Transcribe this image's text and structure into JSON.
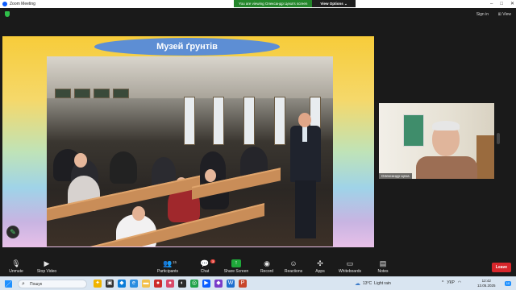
{
  "window": {
    "title": "Zoom Meeting",
    "controls": [
      "–",
      "□",
      "✕"
    ]
  },
  "view_banner": {
    "message": "You are viewing Олександр Цеха's screen",
    "options_label": "View Options ⌄"
  },
  "topbar": {
    "sign_in": "Sign in",
    "view": "⊞ View"
  },
  "slide": {
    "title": "Музей ґрунтів"
  },
  "participant_video": {
    "name": "Олександр Цеха"
  },
  "toolbar": {
    "unmute": "Unmute",
    "stop_video": "Stop Video",
    "participants": "Participants",
    "participants_count": "15",
    "chat": "Chat",
    "chat_badge": "3",
    "share_screen": "Share Screen",
    "record": "Record",
    "reactions": "Reactions",
    "apps": "Apps",
    "whiteboards": "Whiteboards",
    "notes": "Notes",
    "leave": "Leave"
  },
  "taskbar": {
    "search_placeholder": "Пошук",
    "weather_temp": "13°C",
    "weather_desc": "Light rain",
    "language": "УКР",
    "time": "12:42",
    "date": "13.05.2025",
    "notifications": "10"
  },
  "colors": {
    "accent_green": "#1fa83a",
    "leave_red": "#d8262b",
    "slide_title_bg": "#5d8ed4"
  }
}
